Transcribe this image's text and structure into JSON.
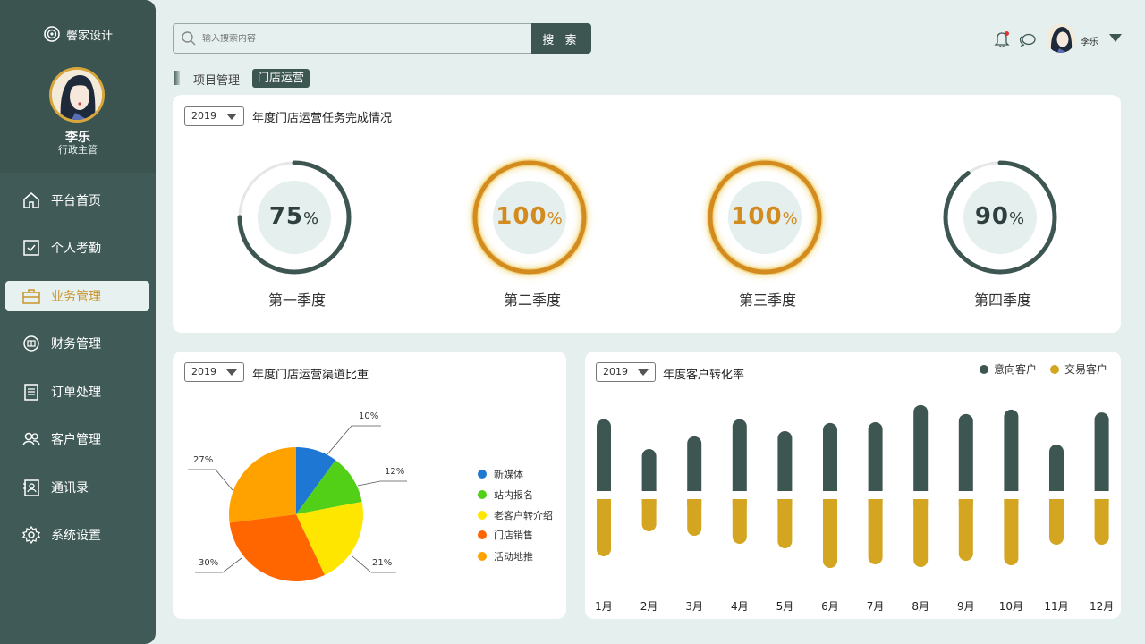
{
  "brand": {
    "name": "馨家设计"
  },
  "profile": {
    "name": "李乐",
    "role": "行政主管"
  },
  "nav": [
    {
      "label": "平台首页",
      "icon": "home-icon"
    },
    {
      "label": "个人考勤",
      "icon": "checkbox-icon"
    },
    {
      "label": "业务管理",
      "icon": "briefcase-icon"
    },
    {
      "label": "财务管理",
      "icon": "finance-icon"
    },
    {
      "label": "订单处理",
      "icon": "order-icon"
    },
    {
      "label": "客户管理",
      "icon": "customers-icon"
    },
    {
      "label": "通讯录",
      "icon": "contacts-icon"
    },
    {
      "label": "系统设置",
      "icon": "settings-icon"
    }
  ],
  "search": {
    "placeholder": "输入搜索内容",
    "button": "搜 索"
  },
  "user": {
    "name": "李乐"
  },
  "breadcrumb": {
    "first": "项目管理",
    "current": "门店运营"
  },
  "task_card": {
    "year": "2019",
    "title": "年度门店运营任务完成情况",
    "quarters": [
      {
        "label": "第一季度",
        "value": "75",
        "unit": "%"
      },
      {
        "label": "第二季度",
        "value": "100",
        "unit": "%"
      },
      {
        "label": "第三季度",
        "value": "100",
        "unit": "%"
      },
      {
        "label": "第四季度",
        "value": "90",
        "unit": "%"
      }
    ]
  },
  "channel_card": {
    "year": "2019",
    "title": "年度门店运营渠道比重"
  },
  "conversion_card": {
    "year": "2019",
    "title": "年度客户转化率",
    "legend_intent": "意向客户",
    "legend_deal": "交易客户"
  },
  "colors": {
    "sidebar": "#405b57",
    "accent": "#3e5652",
    "gold": "#d4a520",
    "orange_ring": "#d38a1f"
  },
  "chart_data": [
    {
      "type": "pie",
      "title": "年度门店运营渠道比重",
      "categories": [
        "新媒体",
        "站内报名",
        "老客户转介绍",
        "门店销售",
        "活动地推"
      ],
      "values": [
        10,
        12,
        21,
        30,
        27
      ],
      "labels": [
        "10%",
        "12%",
        "21%",
        "30%",
        "27%"
      ],
      "colors": [
        "#1f77d4",
        "#52d017",
        "#ffe600",
        "#ff6600",
        "#ffa200"
      ],
      "legend": "right"
    },
    {
      "type": "bar",
      "title": "年度客户转化率",
      "categories": [
        "1月",
        "2月",
        "3月",
        "4月",
        "5月",
        "6月",
        "7月",
        "8月",
        "9月",
        "10月",
        "11月",
        "12月"
      ],
      "series": [
        {
          "name": "意向客户",
          "color": "#3e5652",
          "values": [
            100,
            60,
            77,
            100,
            84,
            95,
            96,
            119,
            107,
            113,
            66,
            109
          ]
        },
        {
          "name": "交易客户",
          "color": "#d4a520",
          "values": [
            67,
            39,
            44,
            53,
            58,
            80,
            76,
            79,
            72,
            77,
            54,
            54
          ]
        }
      ],
      "legend": "top-right"
    }
  ]
}
